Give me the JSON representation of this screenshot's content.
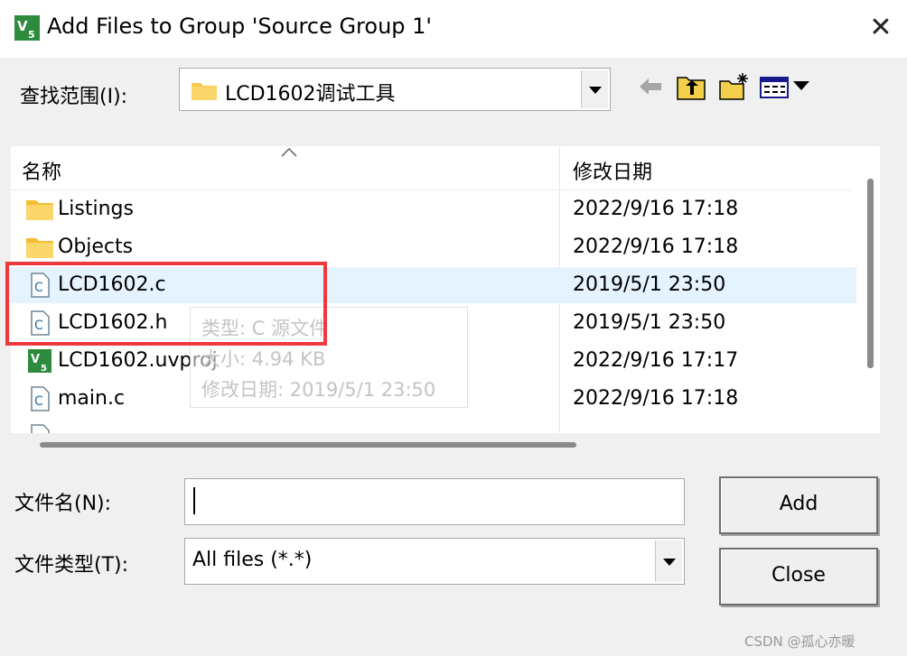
{
  "window": {
    "title": "Add Files to Group 'Source Group 1'"
  },
  "look_in": {
    "label": "查找范围(I):",
    "value": "LCD1602调试工具"
  },
  "columns": {
    "name": "名称",
    "date": "修改日期"
  },
  "files": [
    {
      "name": "Listings",
      "date": "2022/9/16 17:18",
      "icon": "folder-icon"
    },
    {
      "name": "Objects",
      "date": "2022/9/16 17:18",
      "icon": "folder-icon"
    },
    {
      "name": "LCD1602.c",
      "date": "2019/5/1 23:50",
      "icon": "c-file-icon"
    },
    {
      "name": "LCD1602.h",
      "date": "2019/5/1 23:50",
      "icon": "c-file-icon"
    },
    {
      "name": "LCD1602.uvproj",
      "date": "2022/9/16 17:17",
      "icon": "uvision-project-icon"
    },
    {
      "name": "main.c",
      "date": "2022/9/16 17:18",
      "icon": "c-file-icon"
    }
  ],
  "tooltip": {
    "type": "类型: C 源文件",
    "size": "大小: 4.94 KB",
    "modified": "修改日期: 2019/5/1 23:50"
  },
  "file_name": {
    "label": "文件名(N):",
    "value": ""
  },
  "file_type": {
    "label": "文件类型(T):",
    "value": "All files (*.*)"
  },
  "buttons": {
    "add": "Add",
    "close": "Close"
  },
  "watermark": "CSDN @孤心亦暖",
  "colors": {
    "selection": "#e5f3ff",
    "highlight_box": "#ee3a3f",
    "folder": "#f8c94b",
    "uvision_green": "#2e8b3e"
  }
}
